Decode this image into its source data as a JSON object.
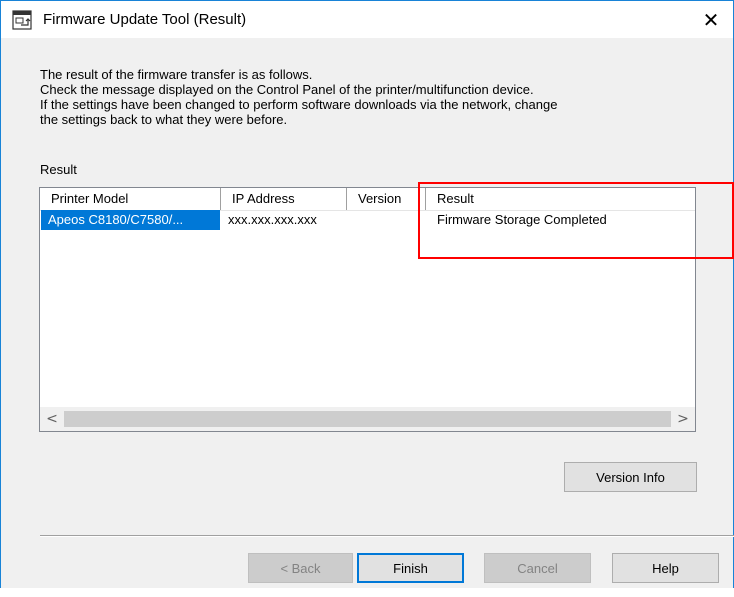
{
  "window": {
    "title": "Firmware Update Tool (Result)",
    "close_glyph": "✕"
  },
  "description": {
    "lines": [
      "The result of the firmware transfer is as follows.",
      "Check the message displayed on the Control Panel of the printer/multifunction device.",
      "If the settings have been changed to perform software downloads via the network, change",
      "the settings back to what they were before."
    ]
  },
  "result_section": {
    "label": "Result",
    "columns": [
      "Printer Model",
      "IP Address",
      "Version",
      "Result"
    ],
    "rows": [
      {
        "printer_model": "Apeos C8180/C7580/...",
        "ip_address": "xxx.xxx.xxx.xxx",
        "version": "",
        "result": "Firmware Storage Completed",
        "selected": true
      }
    ],
    "scroll_left_glyph": "<",
    "scroll_right_glyph": ">"
  },
  "buttons": {
    "version_info": "Version Info",
    "back": "< Back",
    "finish": "Finish",
    "cancel": "Cancel",
    "help": "Help"
  },
  "colors": {
    "selection": "#0078d7",
    "annotation_box": "#ff0000",
    "window_frame": "#1883d7"
  },
  "icons": {
    "app": "firmware-update-app-icon",
    "close": "close-icon"
  }
}
